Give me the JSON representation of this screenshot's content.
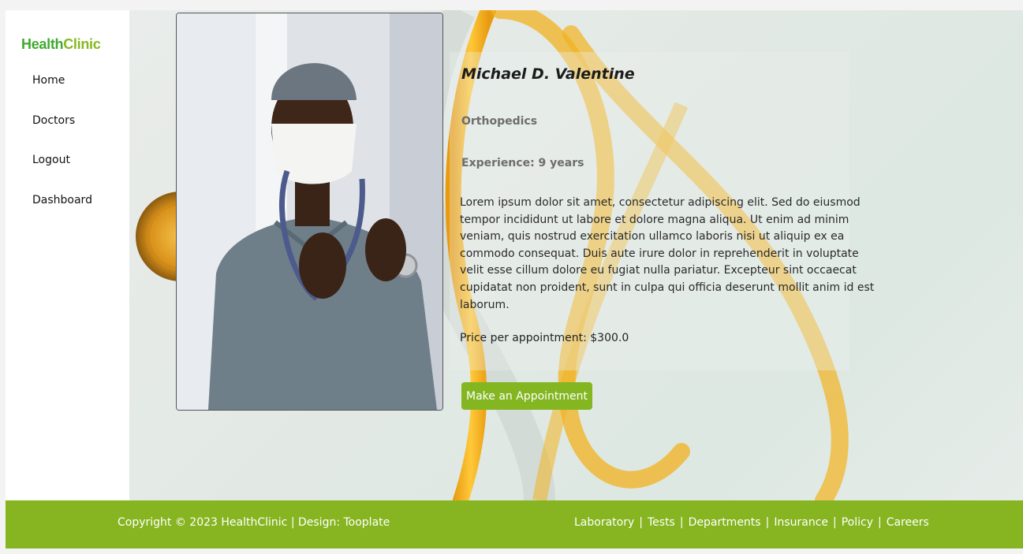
{
  "brand": {
    "part1": "Health",
    "part2": "Clinic"
  },
  "nav": {
    "items": [
      "Home",
      "Doctors",
      "Logout",
      "Dashboard"
    ]
  },
  "doctor": {
    "name": "Michael D. Valentine",
    "specialty": "Orthopedics",
    "experience": "Experience: 9 years",
    "description": "Lorem ipsum dolor sit amet, consectetur adipiscing elit. Sed do eiusmod tempor incididunt ut labore et dolore magna aliqua. Ut enim ad minim veniam, quis nostrud exercitation ullamco laboris nisi ut aliquip ex ea commodo consequat. Duis aute irure dolor in reprehenderit in voluptate velit esse cillum dolore eu fugiat nulla pariatur. Excepteur sint occaecat cupidatat non proident, sunt in culpa qui officia deserunt mollit anim id est laborum.",
    "price": "Price per appointment: $300.0",
    "cta": "Make an Appointment"
  },
  "footer": {
    "copyright": "Copyright © 2023 HealthClinic | Design: Tooplate",
    "links": [
      "Laboratory",
      "Tests",
      "Departments",
      "Insurance",
      "Policy",
      "Careers"
    ]
  },
  "colors": {
    "brand_green": "#86b521",
    "brand_dark_green": "#3fa92f",
    "stethoscope": "#f2b21f"
  }
}
